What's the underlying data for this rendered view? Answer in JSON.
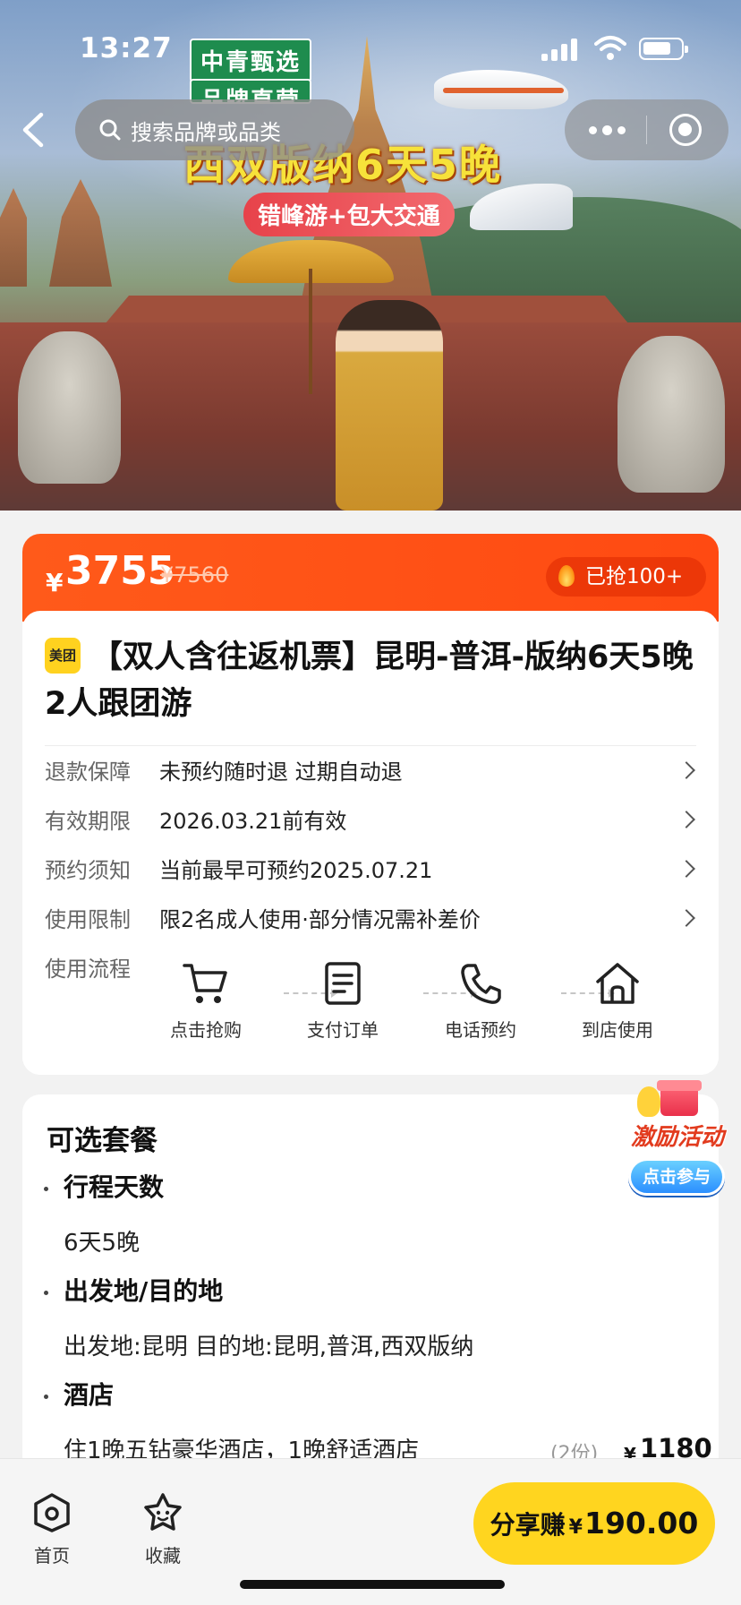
{
  "status_bar": {
    "time": "13:27"
  },
  "hero": {
    "tag_line1": "中青甄选",
    "tag_line2": "品牌直营",
    "headline": "西双版纳6天5晚",
    "subline": "错峰游+包大交通"
  },
  "nav": {
    "search_placeholder": "搜索品牌或品类"
  },
  "price": {
    "currency": "¥",
    "current": "3755",
    "original": "¥7560",
    "sold": "已抢100+"
  },
  "product": {
    "badge": "美团",
    "title": "【双人含往返机票】昆明-普洱-版纳6天5晚2人跟团游"
  },
  "info_rows": [
    {
      "label": "退款保障",
      "value": "未预约随时退 过期自动退"
    },
    {
      "label": "有效期限",
      "value": "2026.03.21前有效"
    },
    {
      "label": "预约须知",
      "value": "当前最早可预约2025.07.21"
    },
    {
      "label": "使用限制",
      "value": "限2名成人使用·部分情况需补差价"
    }
  ],
  "process": {
    "label": "使用流程",
    "steps": [
      {
        "icon": "cart-icon",
        "label": "点击抢购"
      },
      {
        "icon": "order-icon",
        "label": "支付订单"
      },
      {
        "icon": "phone-icon",
        "label": "电话预约"
      },
      {
        "icon": "store-icon",
        "label": "到店使用"
      }
    ]
  },
  "packages": {
    "title": "可选套餐",
    "sections": [
      {
        "title": "行程天数",
        "value": "6天5晚"
      },
      {
        "title": "出发地/目的地",
        "value": "出发地:昆明 目的地:昆明,普洱,西双版纳"
      },
      {
        "title": "酒店",
        "value": "住1晚五钻豪华酒店，1晚舒适酒店"
      }
    ],
    "hotel_option": {
      "count": "(2份)",
      "currency": "¥",
      "price": "1180"
    }
  },
  "activity": {
    "title": "激励活动",
    "button": "点击参与"
  },
  "bottom_bar": {
    "home_label": "首页",
    "fav_label": "收藏",
    "share_label": "分享赚",
    "share_currency": "¥",
    "share_amount": "190.00"
  },
  "colors": {
    "accent_orange": "#ff5a1a",
    "share_yellow": "#ffd51f",
    "meituan_yellow": "#ffd21f"
  }
}
